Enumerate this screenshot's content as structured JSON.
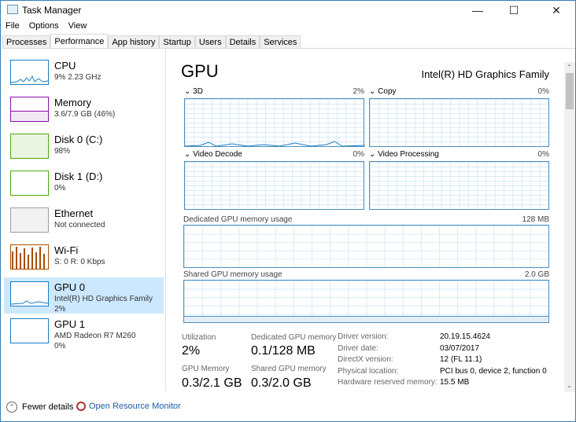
{
  "window": {
    "title": "Task Manager",
    "minimize": "—",
    "maximize": "☐",
    "close": "✕"
  },
  "menu": [
    "File",
    "Options",
    "View"
  ],
  "tabs": [
    "Processes",
    "Performance",
    "App history",
    "Startup",
    "Users",
    "Details",
    "Services"
  ],
  "selected_tab": "Performance",
  "sidebar": [
    {
      "name": "CPU",
      "sub": "9% 2.23 GHz",
      "color": "#1a7dc4"
    },
    {
      "name": "Memory",
      "sub": "3.6/7.9 GB (46%)",
      "color": "#8b12ae"
    },
    {
      "name": "Disk 0 (C:)",
      "sub": "98%",
      "color": "#4da60c"
    },
    {
      "name": "Disk 1 (D:)",
      "sub": "0%",
      "color": "#4da60c"
    },
    {
      "name": "Ethernet",
      "sub": "Not connected",
      "color": "#a0a0a0"
    },
    {
      "name": "Wi-Fi",
      "sub": "S: 0 R: 0 Kbps",
      "color": "#a74f01"
    },
    {
      "name": "GPU 0",
      "sub": "Intel(R) HD Graphics Family",
      "sub2": "2%",
      "color": "#1a7dc4",
      "selected": true
    },
    {
      "name": "GPU 1",
      "sub": "AMD Radeon R7 M260",
      "sub2": "0%",
      "color": "#1a7dc4"
    }
  ],
  "main": {
    "title": "GPU",
    "device": "Intel(R) HD Graphics Family",
    "engines": [
      {
        "name": "3D",
        "value": "2%"
      },
      {
        "name": "Copy",
        "value": "0%"
      },
      {
        "name": "Video Decode",
        "value": "0%"
      },
      {
        "name": "Video Processing",
        "value": "0%"
      }
    ],
    "dedicated": {
      "label": "Dedicated GPU memory usage",
      "max": "128 MB"
    },
    "shared": {
      "label": "Shared GPU memory usage",
      "max": "2.0 GB"
    },
    "stats": {
      "utilization_label": "Utilization",
      "utilization": "2%",
      "dedicated_label": "Dedicated GPU memory",
      "dedicated": "0.1/128 MB",
      "gpu_mem_label": "GPU Memory",
      "gpu_mem": "0.3/2.1 GB",
      "shared_label": "Shared GPU memory",
      "shared": "0.3/2.0 GB"
    },
    "info": [
      {
        "k": "Driver version:",
        "v": "20.19.15.4624"
      },
      {
        "k": "Driver date:",
        "v": "03/07/2017"
      },
      {
        "k": "DirectX version:",
        "v": "12 (FL 11.1)"
      },
      {
        "k": "Physical location:",
        "v": "PCI bus 0, device 2, function 0"
      },
      {
        "k": "Hardware reserved memory:",
        "v": "15.5 MB"
      }
    ]
  },
  "footer": {
    "fewer": "Fewer details",
    "monitor": "Open Resource Monitor"
  }
}
